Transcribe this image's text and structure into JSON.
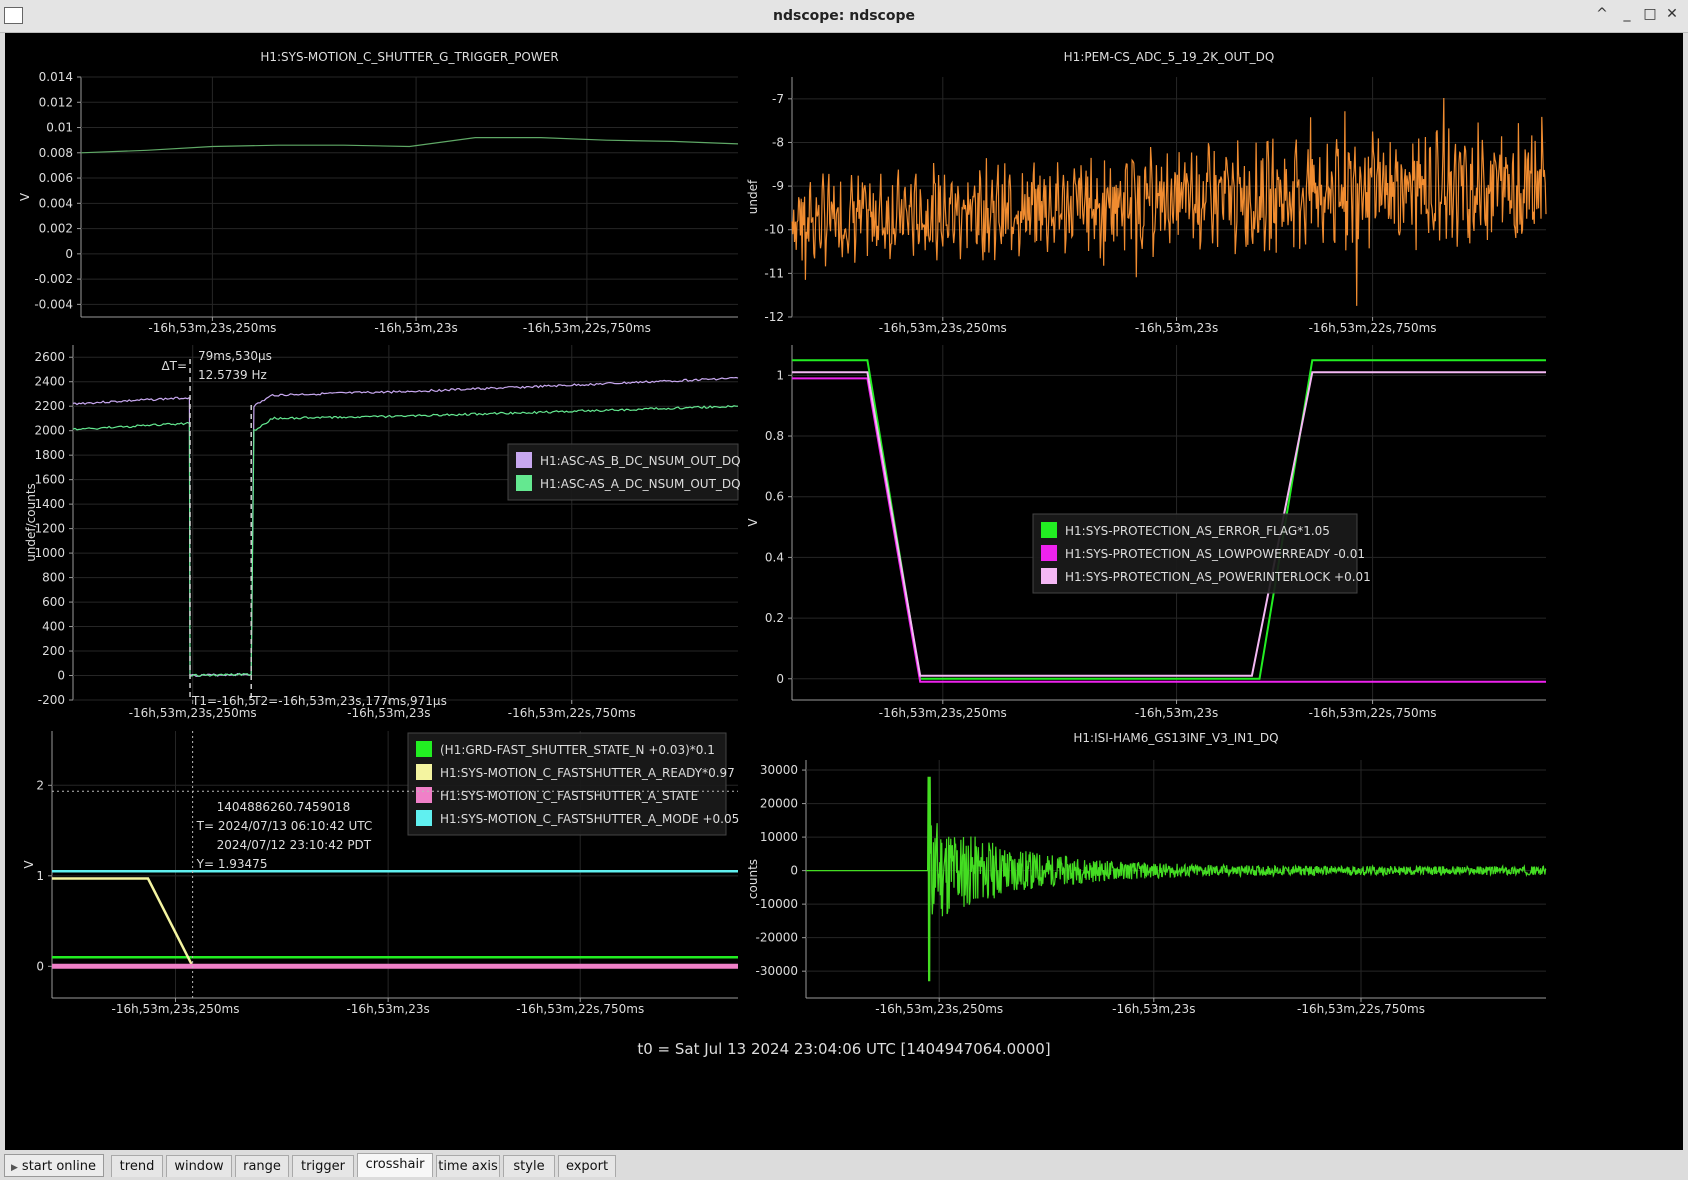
{
  "window": {
    "title": "ndscope: ndscope",
    "controls": [
      "^",
      "_",
      "□",
      "✕"
    ]
  },
  "t0_label": "t0 = Sat Jul 13 2024 23:04:06 UTC [1404947064.0000]",
  "tabs": {
    "start_label": "start online",
    "items": [
      {
        "label": "trend",
        "active": false
      },
      {
        "label": "window",
        "active": false
      },
      {
        "label": "range",
        "active": false
      },
      {
        "label": "trigger",
        "active": false
      },
      {
        "label": "crosshair",
        "active": true
      },
      {
        "label": "time axis",
        "active": false
      },
      {
        "label": "style",
        "active": false
      },
      {
        "label": "export",
        "active": false
      }
    ]
  },
  "chart_data": [
    {
      "type": "line",
      "title": "H1:SYS-MOTION_C_SHUTTER_G_TRIGGER_POWER",
      "ylabel": "V",
      "ylim": [
        -0.005,
        0.014
      ],
      "yticks": [
        "-0.004",
        "-0.002",
        "0",
        "0.002",
        "0.004",
        "0.006",
        "0.008",
        "0.01",
        "0.012",
        "0.014"
      ],
      "xticks": [
        "-16h,53m,23s,250ms",
        "-16h,53m,23s",
        "-16h,53m,22s,750ms"
      ],
      "series": [
        {
          "color": "#5fa866",
          "x": [
            0,
            0.1,
            0.2,
            0.3,
            0.4,
            0.5,
            0.6,
            0.7,
            0.8,
            0.9,
            1.0
          ],
          "y": [
            0.008,
            0.0082,
            0.0085,
            0.0086,
            0.0086,
            0.0085,
            0.0092,
            0.0092,
            0.009,
            0.0089,
            0.0087
          ]
        }
      ]
    },
    {
      "type": "line",
      "title": "H1:PEM-CS_ADC_5_19_2K_OUT_DQ",
      "ylabel": "undef",
      "ylim": [
        -12,
        -6.5
      ],
      "yticks": [
        "-12",
        "-11",
        "-10",
        "-9",
        "-8",
        "-7"
      ],
      "xticks": [
        "-16h,53m,23s,250ms",
        "-16h,53m,23s",
        "-16h,53m,22s,750ms"
      ],
      "series": [
        {
          "color": "#f08c30",
          "style": "noise",
          "center_start": -9.8,
          "center_end": -8.9,
          "amplitude_start": 1.0,
          "amplitude_end": 1.4
        }
      ]
    },
    {
      "type": "line",
      "title": "",
      "ylabel": "undef/counts",
      "ylim": [
        -200,
        2700
      ],
      "yticks": [
        "-200",
        "0",
        "200",
        "400",
        "600",
        "800",
        "1000",
        "1200",
        "1400",
        "1600",
        "1800",
        "2000",
        "2200",
        "2400",
        "2600"
      ],
      "xticks": [
        "-16h,53m,23s,250ms",
        "-16h,53m,23s",
        "-16h,53m,22s,750ms"
      ],
      "legend": [
        "H1:ASC-AS_B_DC_NSUM_OUT_DQ",
        "H1:ASC-AS_A_DC_NSUM_OUT_DQ"
      ],
      "series": [
        {
          "name": "H1:ASC-AS_B_DC_NSUM_OUT_DQ",
          "color": "#c8a8f0",
          "x": [
            0,
            0.175,
            0.176,
            0.268,
            0.272,
            0.3,
            0.5,
            0.7,
            1.0
          ],
          "y": [
            2220,
            2270,
            0,
            10,
            2200,
            2290,
            2320,
            2360,
            2430
          ]
        },
        {
          "name": "H1:ASC-AS_A_DC_NSUM_OUT_DQ",
          "color": "#64e890",
          "x": [
            0,
            0.175,
            0.176,
            0.268,
            0.272,
            0.3,
            0.5,
            0.7,
            1.0
          ],
          "y": [
            2010,
            2060,
            0,
            10,
            2000,
            2100,
            2120,
            2150,
            2200
          ]
        }
      ],
      "cursors": {
        "delta_label": "ΔT=",
        "delta_value": "79ms,530µs",
        "frequency": "12.5739 Hz",
        "t1_label": "T1=-16h,5",
        "t2_label": "T2=-16h,53m,23s,177ms,971µs"
      }
    },
    {
      "type": "line",
      "title": "",
      "ylabel": "V",
      "ylim": [
        -0.07,
        1.1
      ],
      "yticks": [
        "0",
        "0.2",
        "0.4",
        "0.6",
        "0.8",
        "1"
      ],
      "xticks": [
        "-16h,53m,23s,250ms",
        "-16h,53m,23s",
        "-16h,53m,22s,750ms"
      ],
      "legend": [
        "H1:SYS-PROTECTION_AS_ERROR_FLAG*1.05",
        "H1:SYS-PROTECTION_AS_LOWPOWERREADY -0.01",
        "H1:SYS-PROTECTION_AS_POWERINTERLOCK +0.01"
      ],
      "series": [
        {
          "name": "H1:SYS-PROTECTION_AS_ERROR_FLAG*1.05",
          "color": "#22ee22",
          "x": [
            0,
            0.1,
            0.17,
            0.62,
            0.69,
            1.0
          ],
          "y": [
            1.05,
            1.05,
            0,
            0,
            1.05,
            1.05
          ]
        },
        {
          "name": "H1:SYS-PROTECTION_AS_LOWPOWERREADY -0.01",
          "color": "#ee22ee",
          "x": [
            0,
            0.1,
            0.17,
            1.0
          ],
          "y": [
            0.99,
            0.99,
            -0.01,
            -0.01
          ]
        },
        {
          "name": "H1:SYS-PROTECTION_AS_POWERINTERLOCK +0.01",
          "color": "#f4b8f4",
          "x": [
            0,
            0.1,
            0.17,
            0.61,
            0.69,
            1.0
          ],
          "y": [
            1.01,
            1.01,
            0.01,
            0.01,
            1.01,
            1.01
          ]
        }
      ]
    },
    {
      "type": "line",
      "title": "",
      "ylabel": "V",
      "ylim": [
        -0.35,
        2.6
      ],
      "yticks": [
        "0",
        "1",
        "2"
      ],
      "xticks": [
        "-16h,53m,23s,250ms",
        "-16h,53m,23s",
        "-16h,53m,22s,750ms"
      ],
      "legend": [
        "(H1:GRD-FAST_SHUTTER_STATE_N +0.03)*0.1",
        "H1:SYS-MOTION_C_FASTSHUTTER_A_READY*0.97",
        "H1:SYS-MOTION_C_FASTSHUTTER_A_STATE",
        "H1:SYS-MOTION_C_FASTSHUTTER_A_MODE +0.05"
      ],
      "series": [
        {
          "name": "(H1:GRD-FAST_SHUTTER_STATE_N +0.03)*0.1",
          "color": "#22ee22",
          "x": [
            0,
            1.0
          ],
          "y": [
            0.1,
            0.1
          ]
        },
        {
          "name": "H1:SYS-MOTION_C_FASTSHUTTER_A_READY*0.97",
          "color": "#f4f4a0",
          "x": [
            0,
            0.14,
            0.205,
            1.0
          ],
          "y": [
            0.97,
            0.97,
            0,
            0
          ]
        },
        {
          "name": "H1:SYS-MOTION_C_FASTSHUTTER_A_STATE",
          "color": "#f080c8",
          "x": [
            0,
            1.0
          ],
          "y": [
            0,
            0
          ]
        },
        {
          "name": "H1:SYS-MOTION_C_FASTSHUTTER_A_MODE +0.05",
          "color": "#60f0f0",
          "x": [
            0,
            1.0
          ],
          "y": [
            1.05,
            1.05
          ]
        }
      ],
      "crosshair": {
        "gps": "1404886260.7459018",
        "utc": "T= 2024/07/13 06:10:42 UTC",
        "pdt": "2024/07/12 23:10:42 PDT",
        "y": "Y= 1.93475",
        "x_value": 0.205,
        "y_value": 1.93475
      }
    },
    {
      "type": "line",
      "title": "H1:ISI-HAM6_GS13INF_V3_IN1_DQ",
      "ylabel": "counts",
      "ylim": [
        -38000,
        33000
      ],
      "yticks": [
        "-30000",
        "-20000",
        "-10000",
        "0",
        "10000",
        "20000",
        "30000"
      ],
      "xticks": [
        "-16h,53m,23s,250ms",
        "-16h,53m,23s",
        "-16h,53m,22s,750ms"
      ],
      "series": [
        {
          "color": "#44dd22",
          "style": "ringdown",
          "onset": 0.165,
          "peak_high": 28000,
          "peak_low": -33000,
          "baseline": 0
        }
      ]
    }
  ]
}
